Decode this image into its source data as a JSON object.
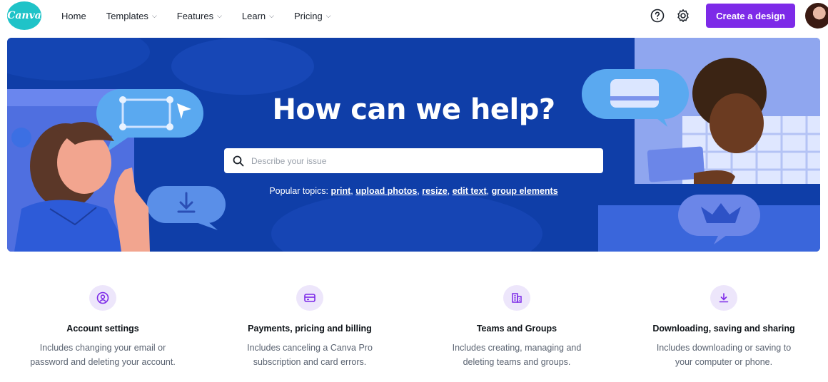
{
  "nav": {
    "logo": "Canva",
    "items": [
      {
        "label": "Home",
        "dropdown": false
      },
      {
        "label": "Templates",
        "dropdown": true
      },
      {
        "label": "Features",
        "dropdown": true
      },
      {
        "label": "Learn",
        "dropdown": true
      },
      {
        "label": "Pricing",
        "dropdown": true
      }
    ],
    "help_icon": "question-circle-icon",
    "settings_icon": "gear-icon",
    "cta": "Create a design",
    "accent": "#7d2ae8"
  },
  "hero": {
    "title": "How can we help?",
    "search_placeholder": "Describe your issue",
    "popular_label": "Popular topics:",
    "topics": [
      "print",
      "upload photos",
      "resize",
      "edit text",
      "group elements"
    ],
    "background": "#0f3ea8"
  },
  "categories": [
    {
      "icon": "user-circle-icon",
      "title": "Account settings",
      "desc_line1": "Includes changing your email or",
      "desc_line2": "password and deleting your account."
    },
    {
      "icon": "credit-card-icon",
      "title": "Payments, pricing and billing",
      "desc_line1": "Includes canceling a Canva Pro",
      "desc_line2": "subscription and card errors."
    },
    {
      "icon": "building-icon",
      "title": "Teams and Groups",
      "desc_line1": "Includes creating, managing and",
      "desc_line2": "deleting teams and groups."
    },
    {
      "icon": "download-icon",
      "title": "Downloading, saving and sharing",
      "desc_line1": "Includes downloading or saving to",
      "desc_line2": "your computer or phone."
    }
  ]
}
